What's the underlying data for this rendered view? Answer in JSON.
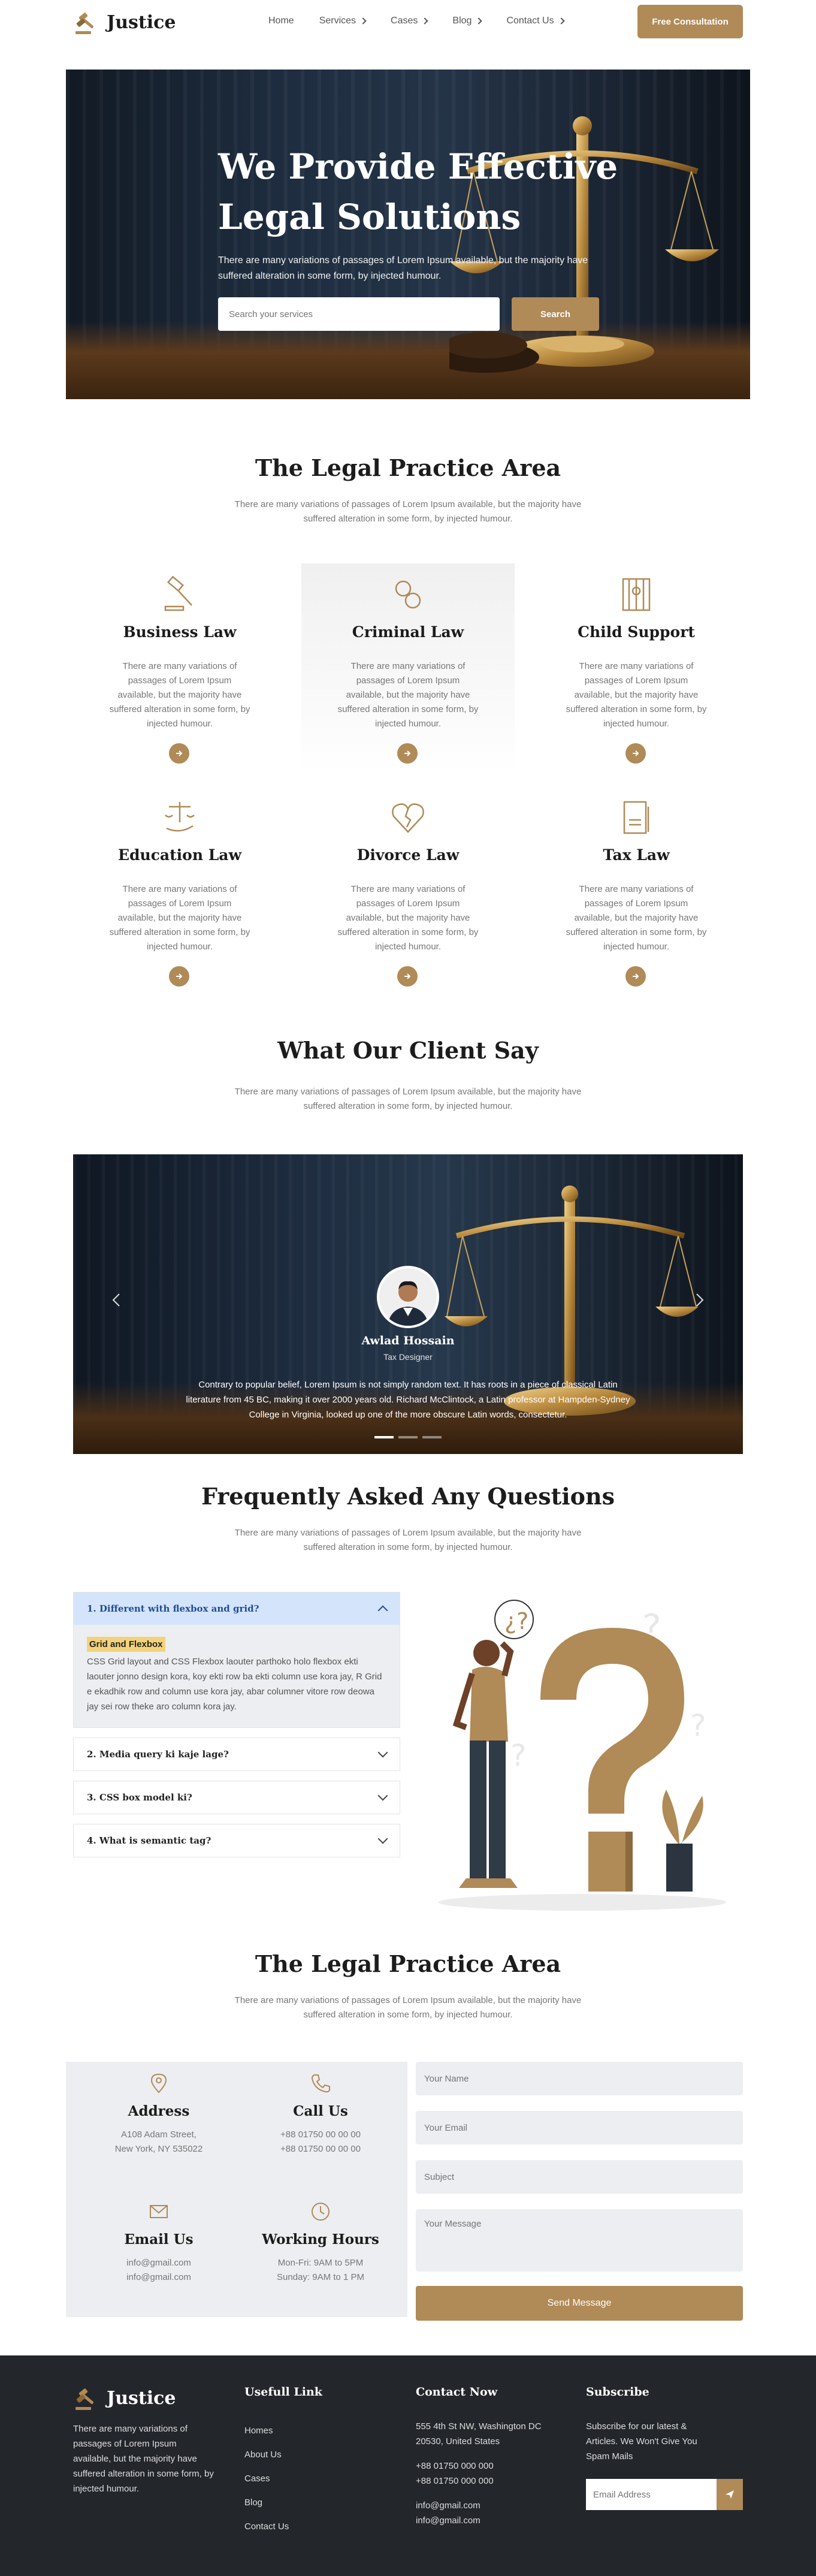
{
  "brand": {
    "name": "Justice",
    "accent": "#b08a57",
    "dark": "#23262b"
  },
  "nav": {
    "items": [
      {
        "label": "Home",
        "dropdown": false
      },
      {
        "label": "Services",
        "dropdown": true
      },
      {
        "label": "Cases",
        "dropdown": true
      },
      {
        "label": "Blog",
        "dropdown": true
      },
      {
        "label": "Contact Us",
        "dropdown": true
      }
    ],
    "cta": "Free Consultation"
  },
  "hero": {
    "title_line1": "We Provide Effective",
    "title_line2": "Legal Solutions",
    "subtitle": "There are many variations of passages of Lorem Ipsum available, but the majority have suffered alteration in some form, by injected humour.",
    "search_placeholder": "Search your services",
    "search_button": "Search"
  },
  "practice": {
    "title": "The Legal Practice Area",
    "subtitle": "There are many variations of passages of Lorem Ipsum available, but the majority have suffered alteration in some form, by injected humour.",
    "cards": [
      {
        "title": "Business Law",
        "icon": "gavel-icon",
        "desc": "There are many variations of passages of Lorem Ipsum available, but the majority have suffered alteration in some form, by injected humour."
      },
      {
        "title": "Criminal Law",
        "icon": "handcuffs-icon",
        "desc": "There are many variations of passages of Lorem Ipsum available, but the majority have suffered alteration in some form, by injected humour."
      },
      {
        "title": "Child Support",
        "icon": "jail-icon",
        "desc": "There are many variations of passages of Lorem Ipsum available, but the majority have suffered alteration in some form, by injected humour."
      },
      {
        "title": "Education Law",
        "icon": "scale-hand-icon",
        "desc": "There are many variations of passages of Lorem Ipsum available, but the majority have suffered alteration in some form, by injected humour."
      },
      {
        "title": "Divorce Law",
        "icon": "broken-heart-icon",
        "desc": "There are many variations of passages of Lorem Ipsum available, but the majority have suffered alteration in some form, by injected humour."
      },
      {
        "title": "Tax Law",
        "icon": "tax-document-icon",
        "desc": "There are many variations of passages of Lorem Ipsum available, but the majority have suffered alteration in some form, by injected humour."
      }
    ]
  },
  "testimonials": {
    "title": "What Our Client Say",
    "subtitle": "There are many variations of passages of Lorem Ipsum available, but the majority have suffered alteration in some form, by injected humour.",
    "name": "Awlad Hossain",
    "role": "Tax Designer",
    "quote": "Contrary to popular belief, Lorem Ipsum is not simply random text. It has roots in a piece of classical Latin literature from 45 BC, making it over 2000 years old. Richard McClintock, a Latin professor at Hampden-Sydney College in Virginia, looked up one of the more obscure Latin words, consectetur."
  },
  "faq": {
    "title": "Frequently Asked Any Questions",
    "subtitle": "There are many variations of passages of Lorem Ipsum available, but the majority have suffered alteration in some form, by injected humour.",
    "items": [
      {
        "q": "1. Different with flexbox and grid?",
        "open": true,
        "highlight": "Grid and Flexbox",
        "a": "CSS Grid layout and CSS Flexbox laouter parthoko holo flexbox ekti laouter jonno design kora, koy ekti row ba ekti column use kora jay, R Grid e ekadhik row and column use kora jay, abar columner vitore row deowa jay sei row theke aro column kora jay."
      },
      {
        "q": "2. Media query ki kaje lage?",
        "open": false
      },
      {
        "q": "3. CSS box model ki?",
        "open": false
      },
      {
        "q": "4. What is semantic tag?",
        "open": false
      }
    ]
  },
  "contact": {
    "title": "The Legal Practice Area",
    "subtitle": "There are many variations of passages of Lorem Ipsum available, but the majority have suffered alteration in some form, by injected humour.",
    "address": {
      "title": "Address",
      "line1": "A108 Adam Street,",
      "line2": "New York, NY 535022"
    },
    "call": {
      "title": "Call Us",
      "line1": "+88 01750 00 00 00",
      "line2": "+88 01750 00 00 00"
    },
    "email": {
      "title": "Email Us",
      "line1": "info@gmail.com",
      "line2": "info@gmail.com"
    },
    "hours": {
      "title": "Working Hours",
      "line1": "Mon-Fri: 9AM to 5PM",
      "line2": "Sunday: 9AM to 1 PM"
    },
    "form": {
      "name_placeholder": "Your Name",
      "email_placeholder": "Your Email",
      "subject_placeholder": "Subject",
      "message_placeholder": "Your Message",
      "submit": "Send Message"
    }
  },
  "footer": {
    "about": "There are many variations of passages of Lorem Ipsum available, but the majority have suffered alteration in some form, by injected humour.",
    "links_title": "Usefull Link",
    "links": [
      "Homes",
      "About Us",
      "Cases",
      "Blog",
      "Contact Us"
    ],
    "contact_title": "Contact Now",
    "contact_address": "555 4th St NW, Washington DC 20530, United States",
    "phone1": "+88 01750 000 000",
    "phone2": "+88 01750 000 000",
    "email1": "info@gmail.com",
    "email2": "info@gmail.com",
    "subscribe_title": "Subscribe",
    "subscribe_text": "Subscribe for our latest & Articles. We Won't Give You Spam Mails",
    "subscribe_placeholder": "Email Address"
  }
}
